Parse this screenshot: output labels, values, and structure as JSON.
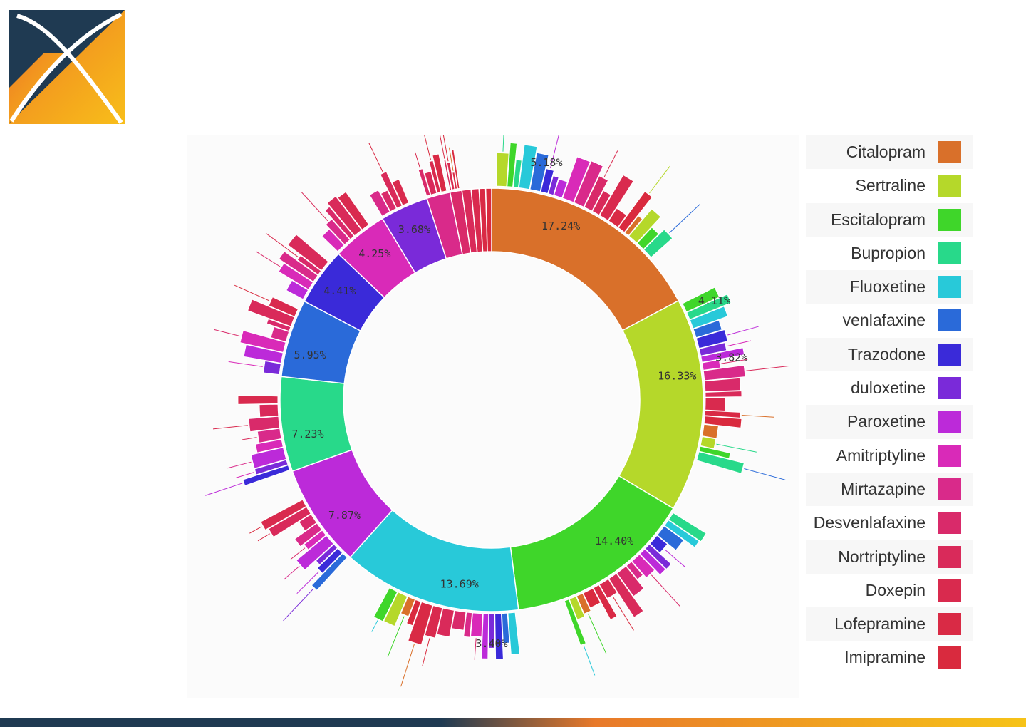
{
  "logo": {
    "name": "x-logo",
    "colors": {
      "dark": "#1f3a52",
      "orange": "#f0901e",
      "yellow": "#f8b81a"
    }
  },
  "legend": {
    "items": [
      {
        "label": "Citalopram",
        "color": "#d9702a"
      },
      {
        "label": "Sertraline",
        "color": "#b5d82a"
      },
      {
        "label": "Escitalopram",
        "color": "#3fd62a"
      },
      {
        "label": "Bupropion",
        "color": "#28d98a"
      },
      {
        "label": "Fluoxetine",
        "color": "#28c9d9"
      },
      {
        "label": "venlafaxine",
        "color": "#2a6ad9"
      },
      {
        "label": "Trazodone",
        "color": "#3a2ad9"
      },
      {
        "label": "duloxetine",
        "color": "#7a2ad9"
      },
      {
        "label": "Paroxetine",
        "color": "#bc2ad9"
      },
      {
        "label": "Amitriptyline",
        "color": "#d92ab8"
      },
      {
        "label": "Mirtazapine",
        "color": "#d92a8a"
      },
      {
        "label": "Desvenlafaxine",
        "color": "#d92a6a"
      },
      {
        "label": "Nortriptyline",
        "color": "#d92a5a"
      },
      {
        "label": "Doxepin",
        "color": "#d92a4e"
      },
      {
        "label": "Lofepramine",
        "color": "#d92a45"
      },
      {
        "label": "Imipramine",
        "color": "#d92a3e"
      }
    ]
  },
  "chart_data": {
    "type": "sunburst",
    "inner_ring": [
      {
        "name": "Citalopram",
        "value": 17.24,
        "label": "17.24%",
        "color": "#d9702a"
      },
      {
        "name": "Sertraline",
        "value": 16.33,
        "label": "16.33%",
        "color": "#b5d82a"
      },
      {
        "name": "Escitalopram",
        "value": 14.4,
        "label": "14.40%",
        "color": "#3fd62a"
      },
      {
        "name": "Fluoxetine",
        "value": 13.69,
        "label": "13.69%",
        "color": "#28c9d9"
      },
      {
        "name": "Paroxetine",
        "value": 7.87,
        "label": "7.87%",
        "color": "#bc2ad9"
      },
      {
        "name": "Bupropion",
        "value": 7.23,
        "label": "7.23%",
        "color": "#28d98a"
      },
      {
        "name": "venlafaxine",
        "value": 5.95,
        "label": "5.95%",
        "color": "#2a6ad9"
      },
      {
        "name": "Trazodone",
        "value": 4.41,
        "label": "4.41%",
        "color": "#3a2ad9"
      },
      {
        "name": "Amitriptyline",
        "value": 4.25,
        "label": "4.25%",
        "color": "#d92ab8"
      },
      {
        "name": "duloxetine",
        "value": 3.68,
        "label": "3.68%",
        "color": "#7a2ad9"
      },
      {
        "name": "Mirtazapine",
        "value": 1.8,
        "label": "",
        "color": "#d92a8a"
      },
      {
        "name": "Desvenlafaxine",
        "value": 0.9,
        "label": "",
        "color": "#d92a6a"
      },
      {
        "name": "Nortriptyline",
        "value": 0.7,
        "label": "",
        "color": "#d92a5a"
      },
      {
        "name": "Doxepin",
        "value": 0.6,
        "label": "",
        "color": "#d92a4e"
      },
      {
        "name": "Lofepramine",
        "value": 0.5,
        "label": "",
        "color": "#d92a45"
      },
      {
        "name": "Imipramine",
        "value": 0.45,
        "label": "",
        "color": "#d92a3e"
      }
    ],
    "outer_labels": [
      {
        "label": "5.18%",
        "angle": 13
      },
      {
        "label": "4.11%",
        "angle": 66
      },
      {
        "label": "3.82%",
        "angle": 80
      },
      {
        "label": "3.40%",
        "angle": 180
      }
    ]
  }
}
